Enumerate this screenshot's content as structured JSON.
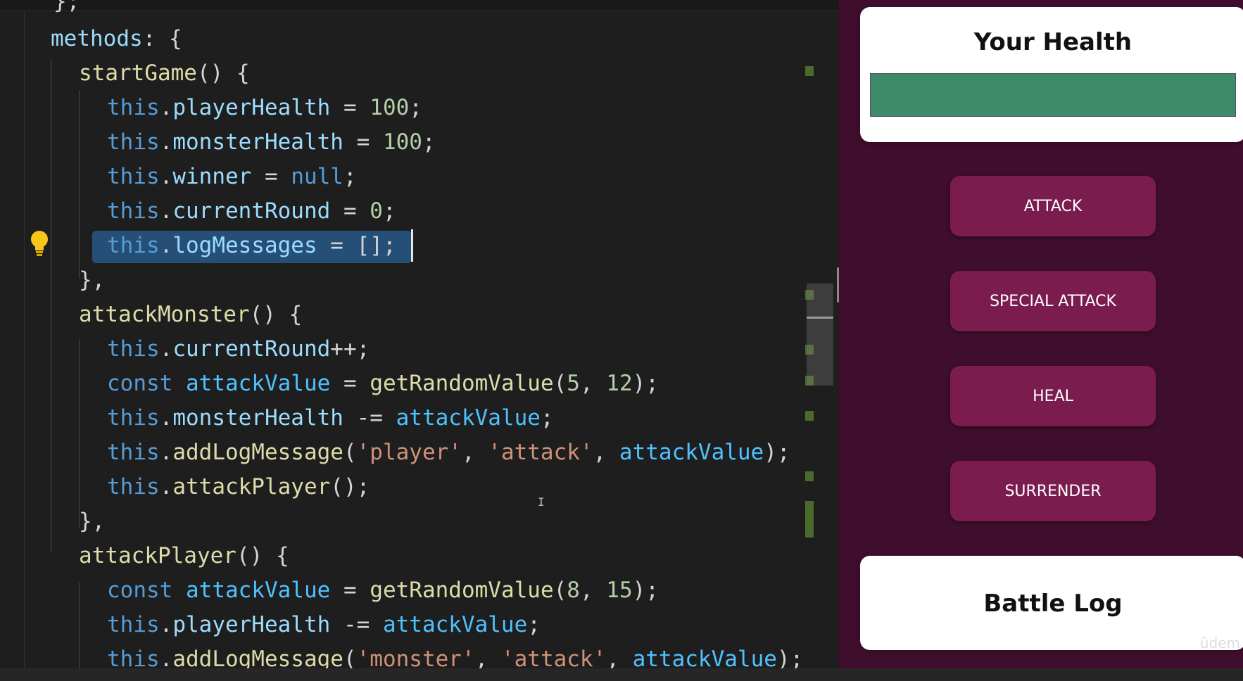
{
  "editor": {
    "top_fragment": "};",
    "lines": [
      [
        [
          "methods",
          "var"
        ],
        [
          ": {",
          "punc"
        ]
      ],
      [
        [
          "startGame",
          "fn"
        ],
        [
          "() {",
          "punc"
        ]
      ],
      [
        [
          "this",
          "kw"
        ],
        [
          ".",
          "punc"
        ],
        [
          "playerHealth",
          "var"
        ],
        [
          " = ",
          "punc"
        ],
        [
          "100",
          "num"
        ],
        [
          ";",
          "punc"
        ]
      ],
      [
        [
          "this",
          "kw"
        ],
        [
          ".",
          "punc"
        ],
        [
          "monsterHealth",
          "var"
        ],
        [
          " = ",
          "punc"
        ],
        [
          "100",
          "num"
        ],
        [
          ";",
          "punc"
        ]
      ],
      [
        [
          "this",
          "kw"
        ],
        [
          ".",
          "punc"
        ],
        [
          "winner",
          "var"
        ],
        [
          " = ",
          "punc"
        ],
        [
          "null",
          "kw"
        ],
        [
          ";",
          "punc"
        ]
      ],
      [
        [
          "this",
          "kw"
        ],
        [
          ".",
          "punc"
        ],
        [
          "currentRound",
          "var"
        ],
        [
          " = ",
          "punc"
        ],
        [
          "0",
          "num"
        ],
        [
          ";",
          "punc"
        ]
      ],
      [
        [
          "this",
          "kw"
        ],
        [
          ".",
          "punc"
        ],
        [
          "logMessages",
          "var"
        ],
        [
          " = [];",
          "punc"
        ]
      ],
      [
        [
          "},",
          "punc"
        ]
      ],
      [
        [
          "attackMonster",
          "fn"
        ],
        [
          "() {",
          "punc"
        ]
      ],
      [
        [
          "this",
          "kw"
        ],
        [
          ".",
          "punc"
        ],
        [
          "currentRound",
          "var"
        ],
        [
          "++;",
          "punc"
        ]
      ],
      [
        [
          "const",
          "kw"
        ],
        [
          " ",
          "punc"
        ],
        [
          "attackValue",
          "const"
        ],
        [
          " = ",
          "punc"
        ],
        [
          "getRandomValue",
          "fn"
        ],
        [
          "(",
          "punc"
        ],
        [
          "5",
          "num"
        ],
        [
          ", ",
          "punc"
        ],
        [
          "12",
          "num"
        ],
        [
          ");",
          "punc"
        ]
      ],
      [
        [
          "this",
          "kw"
        ],
        [
          ".",
          "punc"
        ],
        [
          "monsterHealth",
          "var"
        ],
        [
          " -= ",
          "punc"
        ],
        [
          "attackValue",
          "const"
        ],
        [
          ";",
          "punc"
        ]
      ],
      [
        [
          "this",
          "kw"
        ],
        [
          ".",
          "punc"
        ],
        [
          "addLogMessage",
          "fn"
        ],
        [
          "(",
          "punc"
        ],
        [
          "'player'",
          "str"
        ],
        [
          ", ",
          "punc"
        ],
        [
          "'attack'",
          "str"
        ],
        [
          ", ",
          "punc"
        ],
        [
          "attackValue",
          "const"
        ],
        [
          ");",
          "punc"
        ]
      ],
      [
        [
          "this",
          "kw"
        ],
        [
          ".",
          "punc"
        ],
        [
          "attackPlayer",
          "fn"
        ],
        [
          "();",
          "punc"
        ]
      ],
      [
        [
          "},",
          "punc"
        ]
      ],
      [
        [
          "attackPlayer",
          "fn"
        ],
        [
          "() {",
          "punc"
        ]
      ],
      [
        [
          "const",
          "kw"
        ],
        [
          " ",
          "punc"
        ],
        [
          "attackValue",
          "const"
        ],
        [
          " = ",
          "punc"
        ],
        [
          "getRandomValue",
          "fn"
        ],
        [
          "(",
          "punc"
        ],
        [
          "8",
          "num"
        ],
        [
          ", ",
          "punc"
        ],
        [
          "15",
          "num"
        ],
        [
          ");",
          "punc"
        ]
      ],
      [
        [
          "this",
          "kw"
        ],
        [
          ".",
          "punc"
        ],
        [
          "playerHealth",
          "var"
        ],
        [
          " -= ",
          "punc"
        ],
        [
          "attackValue",
          "const"
        ],
        [
          ";",
          "punc"
        ]
      ],
      [
        [
          "this",
          "kw"
        ],
        [
          ".",
          "punc"
        ],
        [
          "addLogMessage",
          "fn"
        ],
        [
          "(",
          "punc"
        ],
        [
          "'monster'",
          "str"
        ],
        [
          ", ",
          "punc"
        ],
        [
          "'attack'",
          "str"
        ],
        [
          ", ",
          "punc"
        ],
        [
          "attackValue",
          "const"
        ],
        [
          ");",
          "punc"
        ]
      ]
    ],
    "selected_line": 6,
    "lightbulb_icon": "lightbulb-icon"
  },
  "preview": {
    "health_title": "Your Health",
    "health_fill_percent": 100,
    "buttons": [
      "ATTACK",
      "SPECIAL ATTACK",
      "HEAL",
      "SURRENDER"
    ],
    "battle_log_title": "Battle Log",
    "watermark": "ûdem"
  },
  "colors": {
    "preview_bg": "#3f0e2d",
    "button_bg": "#7a1d4e",
    "health_green": "#3d8b6b",
    "selection": "#264f78"
  }
}
